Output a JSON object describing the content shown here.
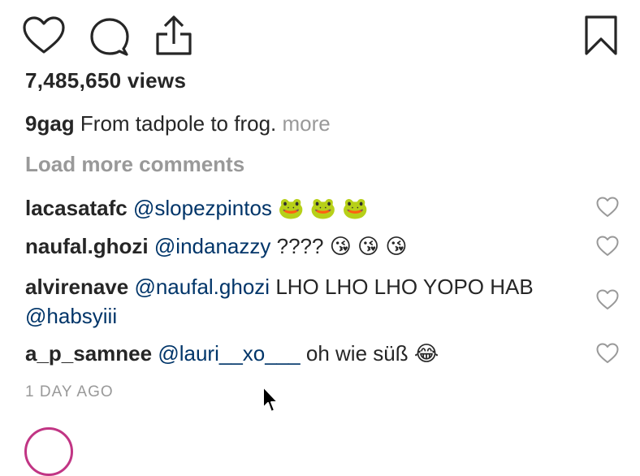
{
  "post": {
    "views": "7,485,650 views",
    "author": "9gag",
    "caption": "From tadpole to frog.",
    "more_label": "more",
    "load_more_label": "Load more comments",
    "timestamp": "1 DAY AGO"
  },
  "actions": {
    "like_icon": "heart-outline",
    "comment_icon": "speech-bubble",
    "share_icon": "share-upload",
    "save_icon": "bookmark"
  },
  "comments": [
    {
      "user": "lacasatafc",
      "mention": "@slopezpintos",
      "text": "",
      "emoji": "🐸 🐸 🐸"
    },
    {
      "user": "naufal.ghozi",
      "mention": "@indanazzy",
      "text": "????",
      "emoji": "😘 😘 😘"
    },
    {
      "user": "alvirenave",
      "mention": "@naufal.ghozi",
      "text": "LHO LHO LHO YOPO HAB",
      "mention2": "@habsyiii"
    },
    {
      "user": "a_p_samnee",
      "mention": "@lauri__xo___",
      "text": "oh wie süß",
      "emoji": "😂"
    }
  ],
  "colors": {
    "text": "#262626",
    "muted": "#999999",
    "mention": "#003569"
  }
}
